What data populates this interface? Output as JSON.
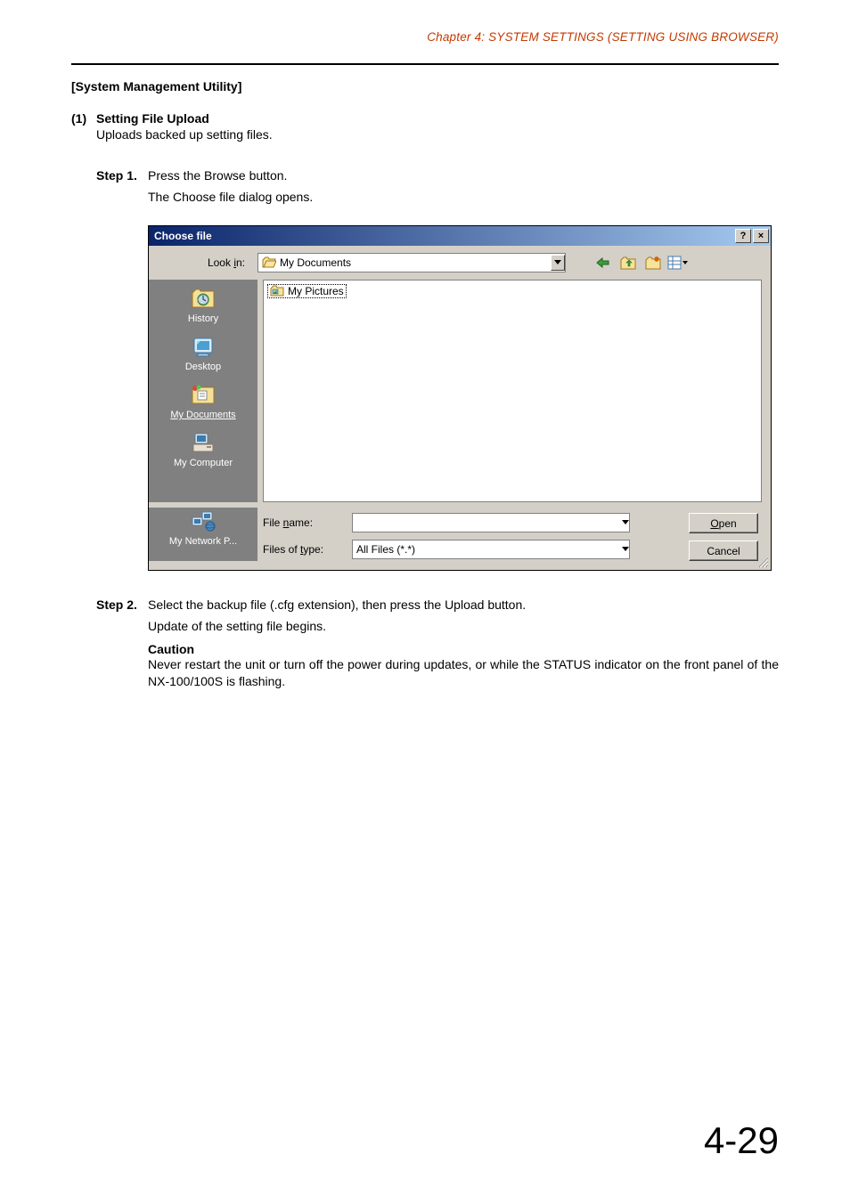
{
  "chapter_header": "Chapter 4:  SYSTEM SETTINGS (SETTING USING BROWSER)",
  "section_heading": "[System Management Utility]",
  "item1": {
    "num": "(1)",
    "title": "Setting File Upload",
    "desc": "Uploads backed up setting files."
  },
  "step1": {
    "label": "Step 1.",
    "text": "Press the Browse button.",
    "sub": "The Choose file dialog opens."
  },
  "dialog": {
    "title": "Choose file",
    "help_btn": "?",
    "close_btn": "×",
    "look_in_label_pre": "Look ",
    "look_in_label_u": "i",
    "look_in_label_post": "n:",
    "look_in_value": "My Documents",
    "sidebar": {
      "history": "History",
      "desktop": "Desktop",
      "mydocs": "My Documents",
      "mycomputer": "My Computer",
      "mynetwork": "My Network P..."
    },
    "file_item": "My Pictures",
    "file_name_label_pre": "File ",
    "file_name_label_u": "n",
    "file_name_label_post": "ame:",
    "file_name_value": "",
    "files_type_label_pre": "Files of ",
    "files_type_label_u": "t",
    "files_type_label_post": "ype:",
    "files_type_value": "All Files (*.*)",
    "open_u": "O",
    "open_post": "pen",
    "cancel": "Cancel"
  },
  "step2": {
    "label": "Step 2.",
    "text": "Select the backup file (.cfg extension), then press the Upload button.",
    "sub": "Update of the setting file begins."
  },
  "caution": {
    "title": "Caution",
    "text": "Never restart the unit or turn off the power during updates, or while the STATUS indicator on the front panel of the NX-100/100S is flashing."
  },
  "page_number": "4-29"
}
